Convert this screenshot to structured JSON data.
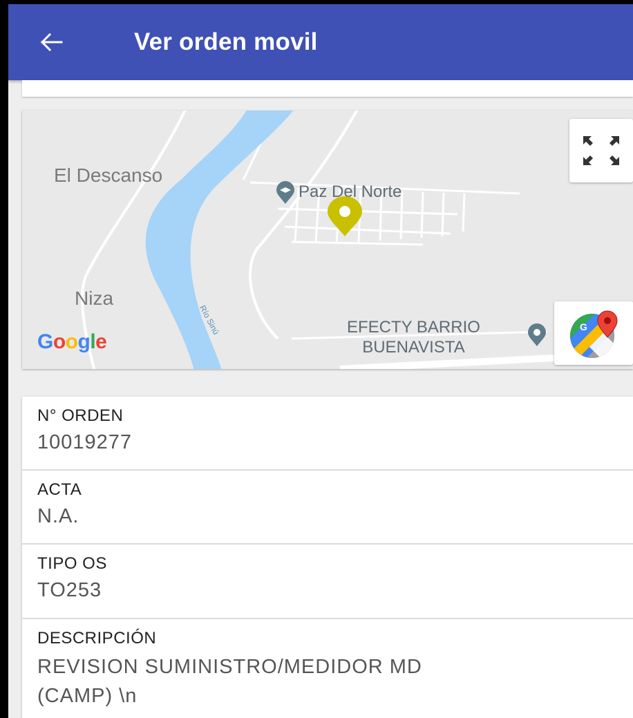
{
  "appbar": {
    "title": "Ver orden movil",
    "back_icon": "arrow-left-icon",
    "background_color": "#3f51b5"
  },
  "map": {
    "labels": {
      "el_descanso": "El Descanso",
      "paz_del_norte": "Paz Del Norte",
      "niza": "Niza",
      "rio_sinu": "Río Sinú",
      "efecty_line1": "EFECTY BARRIO",
      "efecty_line2": "BUENAVISTA"
    },
    "google_logo": {
      "letters": [
        "G",
        "o",
        "o",
        "g",
        "l",
        "e"
      ],
      "colors": [
        "#4285f4",
        "#ea4335",
        "#fbbc05",
        "#4285f4",
        "#34a853",
        "#ea4335"
      ]
    },
    "fullscreen_icon": "expand-icon",
    "directions_icon": "google-maps-icon",
    "marker_color": "#c8c000"
  },
  "details": {
    "fields": [
      {
        "label": "N° ORDEN",
        "value": "10019277"
      },
      {
        "label": "ACTA",
        "value": "N.A."
      },
      {
        "label": "TIPO OS",
        "value": "TO253"
      },
      {
        "label": "DESCRIPCIÓN",
        "value_line1": "REVISION SUMINISTRO/MEDIDOR MD",
        "value_line2": "(CAMP) \\n"
      }
    ]
  }
}
